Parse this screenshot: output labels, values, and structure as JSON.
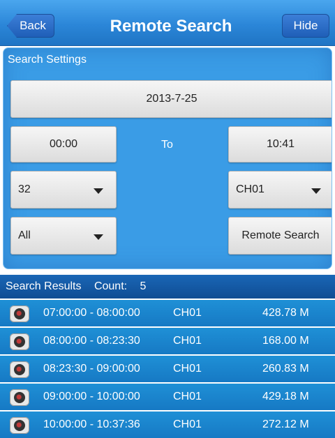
{
  "header": {
    "back_label": "Back",
    "title": "Remote Search",
    "hide_label": "Hide"
  },
  "settings": {
    "section_label": "Search Settings",
    "date": "2013-7-25",
    "start_time": "00:00",
    "to_label": "To",
    "end_time": "10:41",
    "quality_select": "32",
    "channel_select": "CH01",
    "type_select": "All",
    "remote_search_label": "Remote Search"
  },
  "results": {
    "label": "Search Results",
    "count_label": "Count:",
    "count": "5",
    "rows": [
      {
        "time": "07:00:00 - 08:00:00",
        "channel": "CH01",
        "size": "428.78 M"
      },
      {
        "time": "08:00:00 - 08:23:30",
        "channel": "CH01",
        "size": "168.00 M"
      },
      {
        "time": "08:23:30 - 09:00:00",
        "channel": "CH01",
        "size": "260.83 M"
      },
      {
        "time": "09:00:00 - 10:00:00",
        "channel": "CH01",
        "size": "429.18 M"
      },
      {
        "time": "10:00:00 - 10:37:36",
        "channel": "CH01",
        "size": "272.12 M"
      }
    ]
  },
  "icons": {
    "row_icon": "camera-icon",
    "dropdown": "caret-down-icon"
  },
  "colors": {
    "header": "#2b86d8",
    "panel": "#3a9ce6",
    "row": "#1f90d6"
  }
}
